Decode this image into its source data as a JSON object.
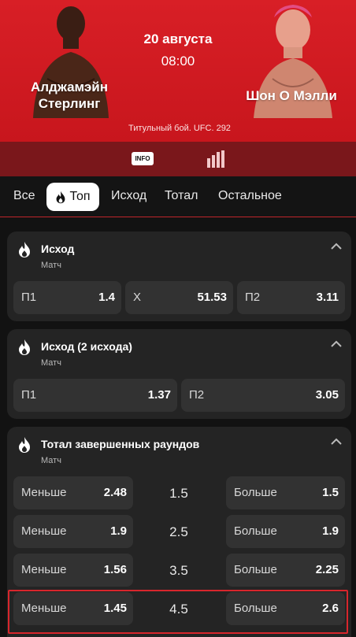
{
  "event": {
    "fighter_left": "Алджамэйн\nСтерлинг",
    "fighter_right": "Шон О Мэлли",
    "date": "20 августа",
    "time": "08:00",
    "subtitle": "Титульный бой. UFC. 292"
  },
  "toolbar": {
    "info_label": "INFO"
  },
  "tabs": [
    "Все",
    "Топ",
    "Исход",
    "Тотал",
    "Остальное"
  ],
  "colors": {
    "accent": "#d81f26",
    "card": "#242424",
    "odd_cell": "#323232"
  },
  "markets": [
    {
      "title": "Исход",
      "sub": "Матч",
      "odds": [
        {
          "label": "П1",
          "value": "1.4"
        },
        {
          "label": "Х",
          "value": "51.53"
        },
        {
          "label": "П2",
          "value": "3.11"
        }
      ]
    },
    {
      "title": "Исход (2 исхода)",
      "sub": "Матч",
      "odds": [
        {
          "label": "П1",
          "value": "1.37"
        },
        {
          "label": "П2",
          "value": "3.05"
        }
      ]
    },
    {
      "title": "Тотал завершенных раундов",
      "sub": "Матч",
      "rows": [
        {
          "under_label": "Меньше",
          "under": "2.48",
          "line": "1.5",
          "over_label": "Больше",
          "over": "1.5"
        },
        {
          "under_label": "Меньше",
          "under": "1.9",
          "line": "2.5",
          "over_label": "Больше",
          "over": "1.9"
        },
        {
          "under_label": "Меньше",
          "under": "1.56",
          "line": "3.5",
          "over_label": "Больше",
          "over": "2.25"
        },
        {
          "under_label": "Меньше",
          "under": "1.45",
          "line": "4.5",
          "over_label": "Больше",
          "over": "2.6"
        }
      ]
    }
  ]
}
